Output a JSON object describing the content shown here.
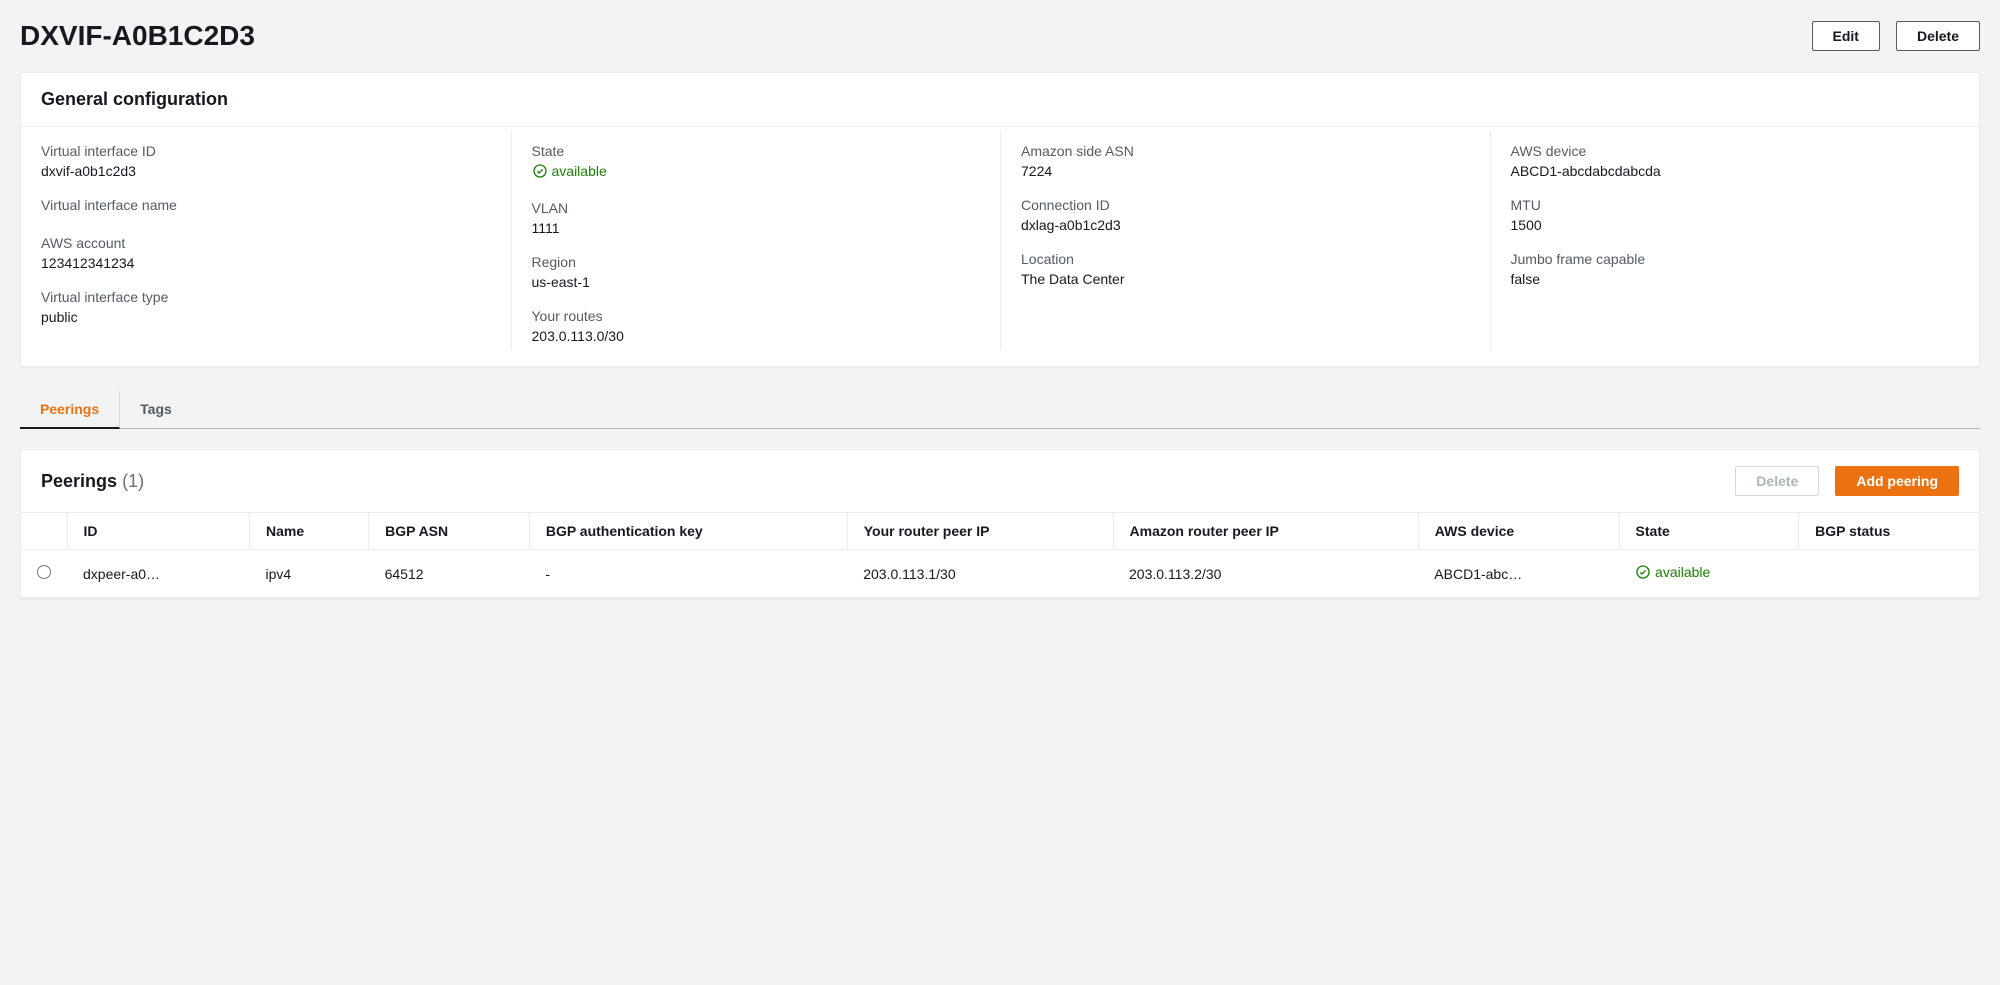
{
  "header": {
    "title": "DXVIF-A0B1C2D3",
    "edit_label": "Edit",
    "delete_label": "Delete"
  },
  "general": {
    "section_title": "General configuration",
    "col1": {
      "vif_id_label": "Virtual interface ID",
      "vif_id_value": "dxvif-a0b1c2d3",
      "vif_name_label": "Virtual interface name",
      "vif_name_value": "",
      "aws_account_label": "AWS account",
      "aws_account_value": "123412341234",
      "vif_type_label": "Virtual interface type",
      "vif_type_value": "public"
    },
    "col2": {
      "state_label": "State",
      "state_value": "available",
      "vlan_label": "VLAN",
      "vlan_value": "1111",
      "region_label": "Region",
      "region_value": "us-east-1",
      "routes_label": "Your routes",
      "routes_value": "203.0.113.0/30"
    },
    "col3": {
      "amz_asn_label": "Amazon side ASN",
      "amz_asn_value": "7224",
      "conn_id_label": "Connection ID",
      "conn_id_value": "dxlag-a0b1c2d3",
      "location_label": "Location",
      "location_value": "The Data Center"
    },
    "col4": {
      "aws_device_label": "AWS device",
      "aws_device_value": "ABCD1-abcdabcdabcda",
      "mtu_label": "MTU",
      "mtu_value": "1500",
      "jumbo_label": "Jumbo frame capable",
      "jumbo_value": "false"
    }
  },
  "tabs": {
    "peerings": "Peerings",
    "tags": "Tags"
  },
  "peerings": {
    "title": "Peerings",
    "count": "(1)",
    "delete_label": "Delete",
    "add_label": "Add peering",
    "columns": {
      "id": "ID",
      "name": "Name",
      "bgp_asn": "BGP ASN",
      "bgp_auth_key": "BGP authentication key",
      "your_router_ip": "Your router peer IP",
      "amazon_router_ip": "Amazon router peer IP",
      "aws_device": "AWS device",
      "state": "State",
      "bgp_status": "BGP status"
    },
    "rows": [
      {
        "id": "dxpeer-a0…",
        "name": "ipv4",
        "bgp_asn": "64512",
        "bgp_auth_key": "-",
        "your_router_ip": "203.0.113.1/30",
        "amazon_router_ip": "203.0.113.2/30",
        "aws_device": "ABCD1-abc…",
        "state": "available"
      }
    ]
  }
}
